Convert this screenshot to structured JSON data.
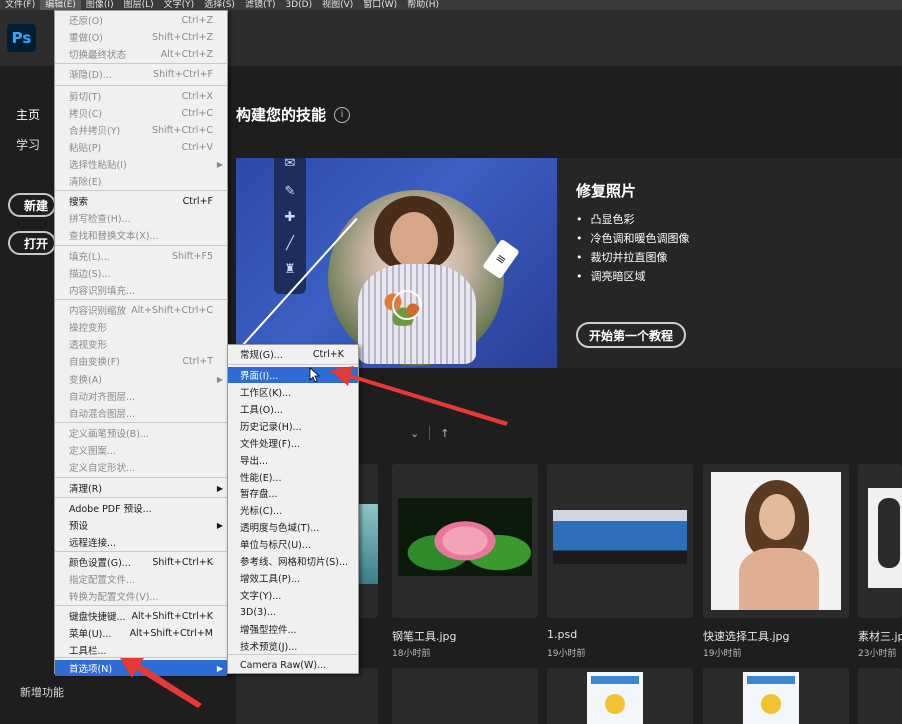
{
  "menubar": [
    "文件(F)",
    "编辑(E)",
    "图像(I)",
    "图层(L)",
    "文字(Y)",
    "选择(S)",
    "滤镜(T)",
    "3D(D)",
    "视图(V)",
    "窗口(W)",
    "帮助(H)"
  ],
  "app": {
    "logo": "Ps"
  },
  "sidebar": {
    "home": "主页",
    "learn": "学习",
    "new": "新建",
    "open": "打开",
    "whats_new": "新增功能"
  },
  "main": {
    "heading": "构建您的技能",
    "info": "i",
    "banner": {
      "title": "修复照片",
      "bullets": [
        "凸显色彩",
        "冷色调和暖色调图像",
        "裁切并拉直图像",
        "调亮暗区域"
      ],
      "button": "开始第一个教程"
    },
    "files": [
      {
        "name": "钢笔工具.jpg",
        "time": "18小时前"
      },
      {
        "name": "1.psd",
        "time": "19小时前"
      },
      {
        "name": "快速选择工具.jpg",
        "time": "19小时前"
      },
      {
        "name": "素材三.jp",
        "time": "23小时前"
      }
    ]
  },
  "edit_menu": {
    "items": [
      {
        "label": "还原(O)",
        "shortcut": "Ctrl+Z",
        "disabled": true
      },
      {
        "label": "重做(O)",
        "shortcut": "Shift+Ctrl+Z",
        "disabled": true
      },
      {
        "label": "切换最终状态",
        "shortcut": "Alt+Ctrl+Z",
        "disabled": true
      },
      {
        "label": "渐隐(D)...",
        "shortcut": "Shift+Ctrl+F",
        "disabled": true
      },
      {
        "label": "剪切(T)",
        "shortcut": "Ctrl+X",
        "disabled": true
      },
      {
        "label": "拷贝(C)",
        "shortcut": "Ctrl+C",
        "disabled": true
      },
      {
        "label": "合并拷贝(Y)",
        "shortcut": "Shift+Ctrl+C",
        "disabled": true
      },
      {
        "label": "粘贴(P)",
        "shortcut": "Ctrl+V",
        "disabled": true
      },
      {
        "label": "选择性粘贴(I)",
        "shortcut": "",
        "disabled": true
      },
      {
        "label": "清除(E)",
        "shortcut": "",
        "disabled": true
      },
      {
        "label": "搜索",
        "shortcut": "Ctrl+F",
        "disabled": false
      },
      {
        "label": "拼写检查(H)...",
        "shortcut": "",
        "disabled": true
      },
      {
        "label": "查找和替换文本(X)...",
        "shortcut": "",
        "disabled": true
      },
      {
        "label": "填充(L)...",
        "shortcut": "Shift+F5",
        "disabled": true
      },
      {
        "label": "描边(S)...",
        "shortcut": "",
        "disabled": true
      },
      {
        "label": "内容识别填充...",
        "shortcut": "",
        "disabled": true
      },
      {
        "label": "内容识别缩放",
        "shortcut": "Alt+Shift+Ctrl+C",
        "disabled": true
      },
      {
        "label": "操控变形",
        "shortcut": "",
        "disabled": true
      },
      {
        "label": "透视变形",
        "shortcut": "",
        "disabled": true
      },
      {
        "label": "自由变换(F)",
        "shortcut": "Ctrl+T",
        "disabled": true
      },
      {
        "label": "变换(A)",
        "shortcut": "",
        "disabled": true
      },
      {
        "label": "自动对齐图层...",
        "shortcut": "",
        "disabled": true
      },
      {
        "label": "自动混合图层...",
        "shortcut": "",
        "disabled": true
      },
      {
        "label": "定义画笔预设(B)...",
        "shortcut": "",
        "disabled": true
      },
      {
        "label": "定义图案...",
        "shortcut": "",
        "disabled": true
      },
      {
        "label": "定义自定形状...",
        "shortcut": "",
        "disabled": true
      },
      {
        "label": "清理(R)",
        "shortcut": "",
        "disabled": false
      },
      {
        "label": "Adobe PDF 预设...",
        "shortcut": "",
        "disabled": false
      },
      {
        "label": "预设",
        "shortcut": "",
        "disabled": false
      },
      {
        "label": "远程连接...",
        "shortcut": "",
        "disabled": false
      },
      {
        "label": "颜色设置(G)...",
        "shortcut": "Shift+Ctrl+K",
        "disabled": false
      },
      {
        "label": "指定配置文件...",
        "shortcut": "",
        "disabled": true
      },
      {
        "label": "转换为配置文件(V)...",
        "shortcut": "",
        "disabled": true
      },
      {
        "label": "键盘快捷键...",
        "shortcut": "Alt+Shift+Ctrl+K",
        "disabled": false
      },
      {
        "label": "菜单(U)...",
        "shortcut": "Alt+Shift+Ctrl+M",
        "disabled": false
      },
      {
        "label": "工具栏...",
        "shortcut": "",
        "disabled": false
      },
      {
        "label": "首选项(N)",
        "shortcut": "",
        "disabled": false
      }
    ]
  },
  "pref_menu": {
    "items": [
      {
        "label": "常规(G)...",
        "shortcut": "Ctrl+K"
      },
      {
        "label": "界面(I)...",
        "shortcut": ""
      },
      {
        "label": "工作区(K)...",
        "shortcut": ""
      },
      {
        "label": "工具(O)...",
        "shortcut": ""
      },
      {
        "label": "历史记录(H)...",
        "shortcut": ""
      },
      {
        "label": "文件处理(F)...",
        "shortcut": ""
      },
      {
        "label": "导出...",
        "shortcut": ""
      },
      {
        "label": "性能(E)...",
        "shortcut": ""
      },
      {
        "label": "暂存盘...",
        "shortcut": ""
      },
      {
        "label": "光标(C)...",
        "shortcut": ""
      },
      {
        "label": "透明度与色域(T)...",
        "shortcut": ""
      },
      {
        "label": "单位与标尺(U)...",
        "shortcut": ""
      },
      {
        "label": "参考线、网格和切片(S)...",
        "shortcut": ""
      },
      {
        "label": "增效工具(P)...",
        "shortcut": ""
      },
      {
        "label": "文字(Y)...",
        "shortcut": ""
      },
      {
        "label": "3D(3)...",
        "shortcut": ""
      },
      {
        "label": "增强型控件...",
        "shortcut": ""
      },
      {
        "label": "技术预览(J)...",
        "shortcut": ""
      },
      {
        "label": "Camera Raw(W)...",
        "shortcut": ""
      }
    ]
  },
  "colors": {
    "highlight": "#2f6bd4",
    "arrow": "#e53935",
    "ps_blue": "#31a8ff"
  }
}
